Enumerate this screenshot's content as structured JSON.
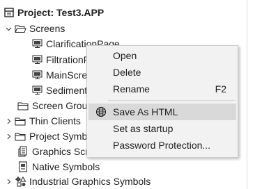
{
  "tree": {
    "project_label": "Project: Test3.APP",
    "screens_label": "Screens",
    "screen_items": [
      {
        "label": "ClarificationPage"
      },
      {
        "label": "FiltrationPage"
      },
      {
        "label": "MainScreen"
      },
      {
        "label": "SedimentationPage"
      }
    ],
    "screen_groups_label": "Screen Groups",
    "thin_clients_label": "Thin Clients",
    "project_symbols_label": "Project Symbols",
    "graphics_scripts_label": "Graphics Scripts",
    "native_symbols_label": "Native Symbols",
    "industrial_graphics_label": "Industrial Graphics Symbols"
  },
  "context_menu": {
    "open": "Open",
    "delete": "Delete",
    "rename": "Rename",
    "rename_shortcut": "F2",
    "save_as_html": "Save As HTML",
    "set_as_startup": "Set as startup",
    "password_protection": "Password Protection..."
  }
}
